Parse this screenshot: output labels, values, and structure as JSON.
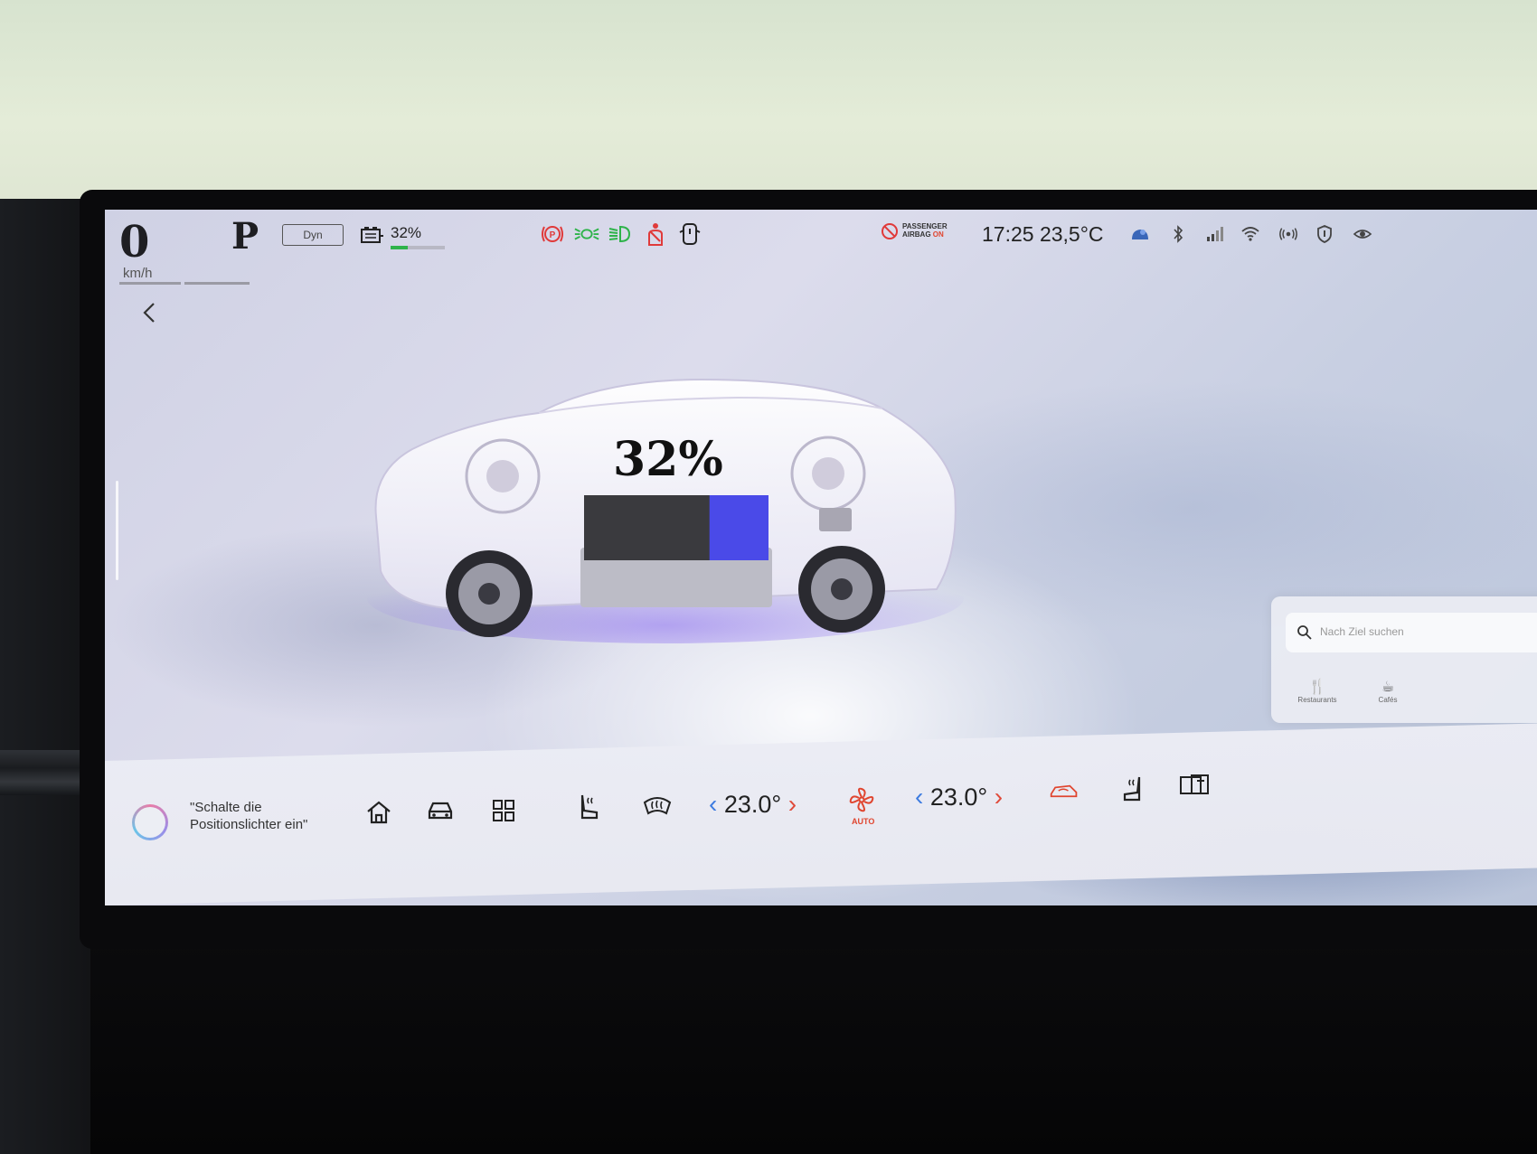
{
  "status_bar": {
    "speed": "0",
    "speed_unit": "km/h",
    "gear": "P",
    "drive_mode": "Dyn",
    "battery_percent_label": "32%",
    "battery_level": 0.32,
    "airbag_label_line1": "PASSENGER",
    "airbag_label_line2": "AIRBAG",
    "airbag_state": "ON",
    "time_temp": "17:25 23,5°C",
    "warning_icons": [
      "parking-brake-icon",
      "parking-lights-icon",
      "headlight-icon",
      "seatbelt-icon",
      "door-open-icon"
    ],
    "status_icons": [
      "weather-icon",
      "bluetooth-icon",
      "cellular-signal-icon",
      "wifi-icon",
      "broadcast-icon",
      "shield-icon",
      "eye-icon"
    ],
    "colors": {
      "warning_red": "#e03a3a",
      "indicator_green": "#2eb34a",
      "battery_fill": "#2eb34a"
    }
  },
  "main": {
    "battery_percent": "32%",
    "battery_level": 0.32,
    "battery_fill_color": "#4a4ae8"
  },
  "nav_panel": {
    "search_placeholder": "Nach Ziel suchen",
    "categories": [
      "Restaurants",
      "Cafés"
    ]
  },
  "dock": {
    "assistant_text_line1": "\"Schalte die",
    "assistant_text_line2": "Positionslichter ein\"",
    "driver_temp": "23.0°",
    "passenger_temp": "23.0°",
    "fan_mode": "AUTO",
    "icons": [
      "home-icon",
      "car-icon",
      "apps-grid-icon",
      "seat-heating-icon",
      "defrost-icon",
      "fan-icon",
      "recirculation-car-icon",
      "passenger-seat-heating-icon",
      "screen-switch-icon"
    ],
    "colors": {
      "chevron_blue": "#3d7be0",
      "chevron_red": "#e04a3a",
      "accent_orange": "#e0452f"
    }
  }
}
